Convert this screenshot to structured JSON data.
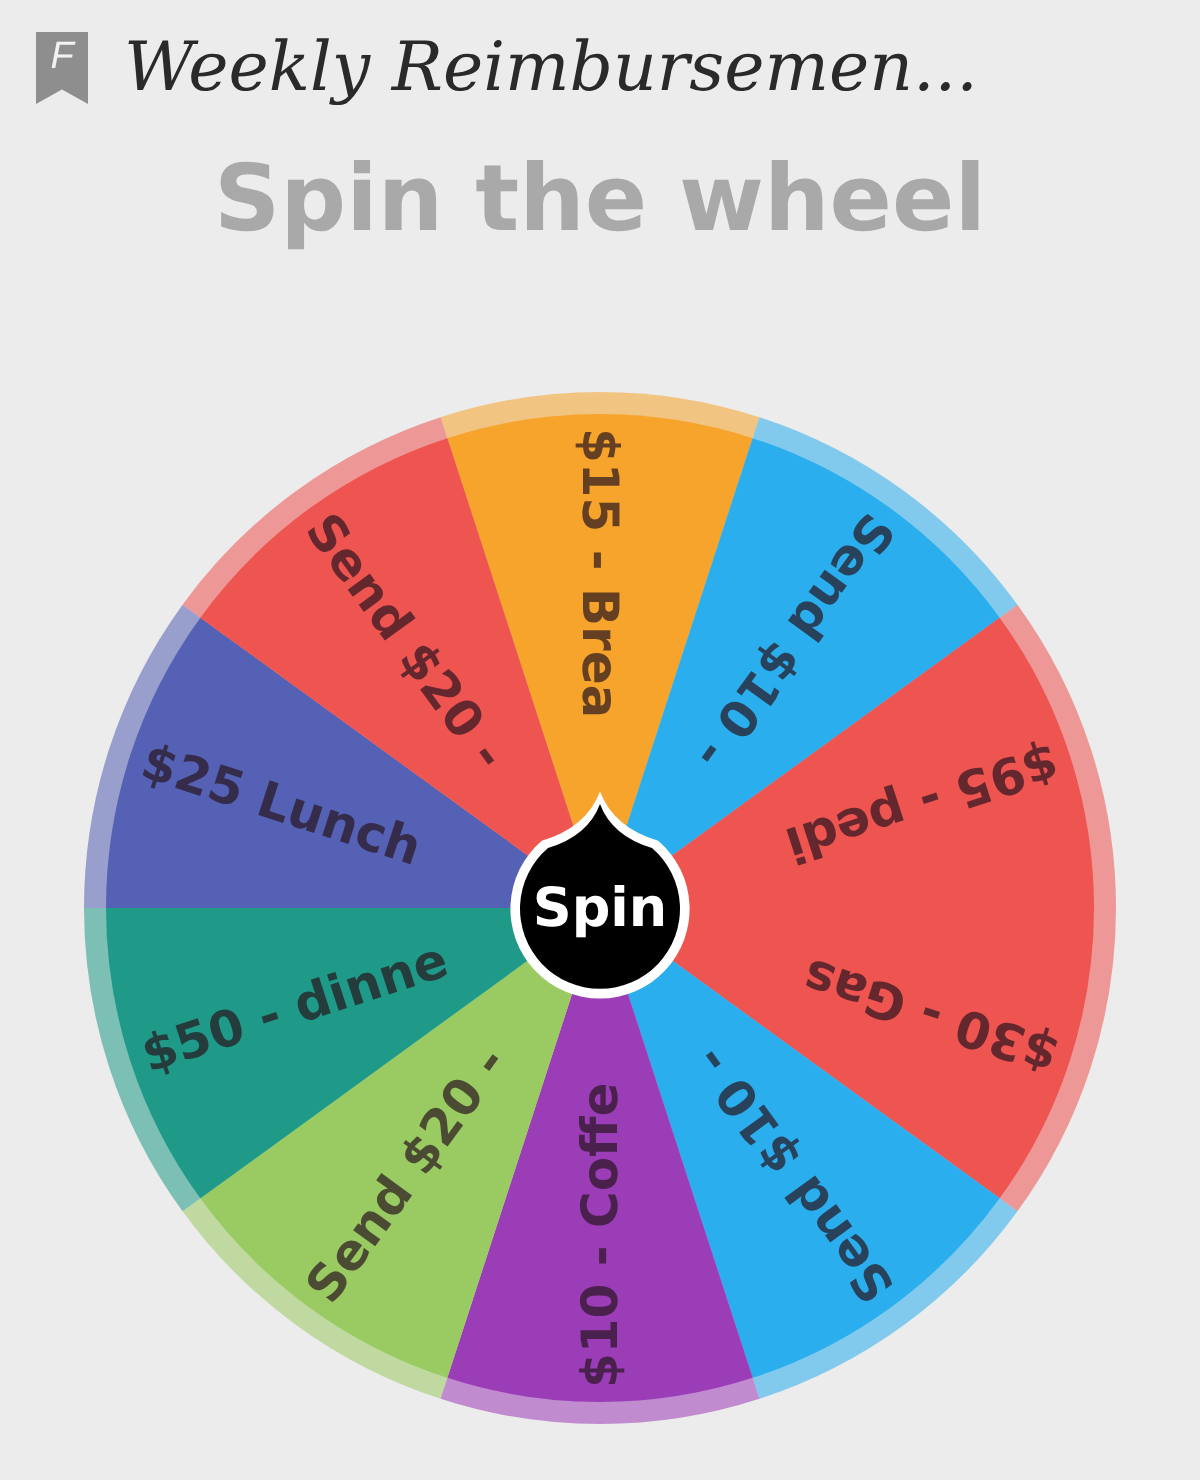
{
  "header": {
    "icon_letter": "F",
    "title": "Weekly Reimbursemen..."
  },
  "heading": "Spin the wheel",
  "wheel": {
    "segments": [
      {
        "label": "$15 - Brea",
        "color": "#f6a42c"
      },
      {
        "label": "Send $10 -",
        "color": "#2aaeee"
      },
      {
        "label": "$95 - pedi",
        "color": "#ee5450"
      },
      {
        "label": "$30 - Gas",
        "color": "#ee5450"
      },
      {
        "label": "Send $10 -",
        "color": "#2aaeee"
      },
      {
        "label": "$10 - Coffe",
        "color": "#9c3db8"
      },
      {
        "label": "Send $20 -",
        "color": "#9acb63"
      },
      {
        "label": "$50 - dinne",
        "color": "#1f9a88"
      },
      {
        "label": "$25 Lunch",
        "color": "#5461b4"
      },
      {
        "label": "Send $20 -",
        "color": "#ee5450"
      }
    ],
    "button": "Spin"
  }
}
